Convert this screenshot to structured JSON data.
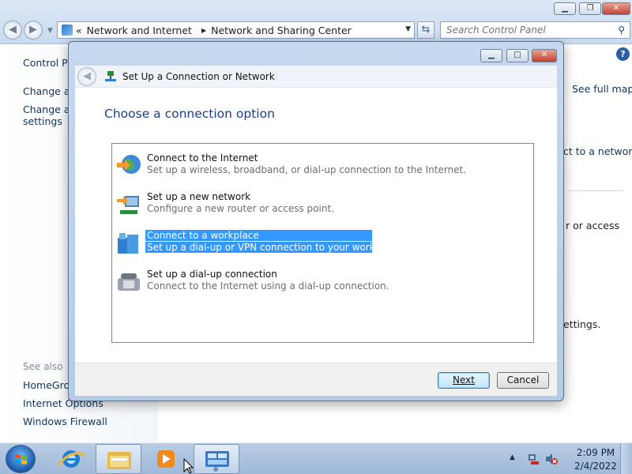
{
  "explorer": {
    "breadcrumb": {
      "overflow": "«",
      "items": [
        "Network and Internet",
        "Network and Sharing Center"
      ]
    },
    "search": {
      "placeholder": "Search Control Panel"
    },
    "sidebar": {
      "links": [
        "Control Pa",
        "Change ad",
        "Change ad",
        "settings"
      ],
      "see_also_heading": "See also",
      "see_also": [
        "HomeGrou",
        "Internet Options",
        "Windows Firewall"
      ]
    },
    "main": {
      "see_full_map": "See full map",
      "connect_to_network": "ct to a network",
      "or_access": "r or access",
      "settings": "ettings."
    },
    "help": "?"
  },
  "dialog": {
    "title": "Set Up a Connection or Network",
    "heading": "Choose a connection option",
    "options": [
      {
        "title": "Connect to the Internet",
        "description": "Set up a wireless, broadband, or dial-up connection to the Internet.",
        "icon": "globe-icon"
      },
      {
        "title": "Set up a new network",
        "description": "Configure a new router or access point.",
        "icon": "router-icon"
      },
      {
        "title": "Connect to a workplace",
        "description": "Set up a dial-up or VPN connection to your workplace.",
        "icon": "workplace-icon",
        "selected": true
      },
      {
        "title": "Set up a dial-up connection",
        "description": "Connect to the Internet using a dial-up connection.",
        "icon": "phone-icon"
      }
    ],
    "buttons": {
      "next": "Next",
      "cancel": "Cancel"
    }
  },
  "taskbar": {
    "items": [
      "internet-explorer-icon",
      "windows-explorer-icon",
      "media-player-icon",
      "control-panel-icon"
    ],
    "clock": {
      "time": "2:09 PM",
      "date": "2/4/2022"
    }
  },
  "colors": {
    "selection": "#3399ff",
    "heading": "#1e3d8a",
    "link": "#12345a"
  }
}
